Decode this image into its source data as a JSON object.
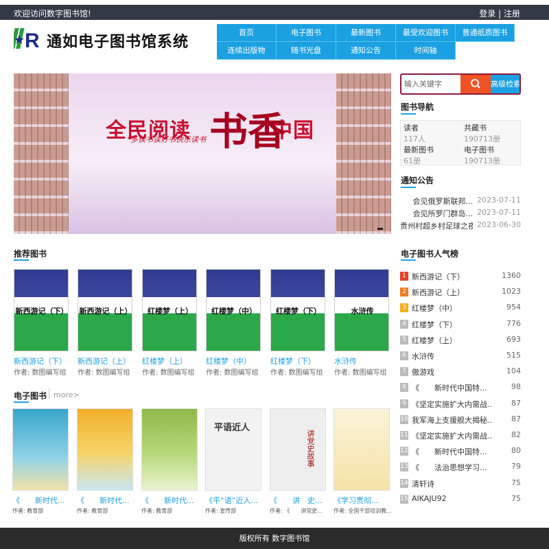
{
  "topbar": {
    "welcome": "欢迎访问数字图书馆!",
    "login": "登录",
    "sep": "|",
    "register": "注册"
  },
  "header": {
    "logo_mark": "R",
    "title": "通如电子图书馆系统"
  },
  "nav": [
    "首页",
    "电子图书",
    "最新图书",
    "最受欢迎图书",
    "普通纸质图书",
    "连续出版物",
    "随书光盘",
    "通知公告",
    "时间轴"
  ],
  "banner": {
    "main": "全民阅读",
    "big": "书香",
    "tail": "中国",
    "sub": "多读书读好书快乐读书"
  },
  "search": {
    "placeholder": "输入关键字",
    "advanced": "高级检索"
  },
  "book_nav": {
    "title": "图书导航",
    "stats": [
      {
        "label": "读者",
        "value": "117人"
      },
      {
        "label": "共藏书",
        "value": "190713册"
      },
      {
        "label": "最新图书",
        "value": "61册"
      },
      {
        "label": "电子图书",
        "value": "190713册"
      }
    ]
  },
  "notices": {
    "title": "通知公告",
    "items": [
      {
        "text": "会见俄罗斯联邦...",
        "date": "2023-07-11"
      },
      {
        "text": "会见所罗门群岛...",
        "date": "2023-07-11"
      },
      {
        "text": "贵州村超乡村足球之夜...",
        "date": "2023-06-30"
      }
    ]
  },
  "recommended": {
    "title": "推荐图书",
    "books": [
      {
        "cover": "新西游记（下）",
        "name": "新西游记（下）",
        "author": "作者: 数图编写组"
      },
      {
        "cover": "新西游记（上）",
        "name": "新西游记（上）",
        "author": "作者: 数图编写组"
      },
      {
        "cover": "红楼梦（上）",
        "name": "红楼梦（上）",
        "author": "作者: 数图编写组"
      },
      {
        "cover": "红楼梦（中）",
        "name": "红楼梦（中）",
        "author": "作者: 数图编写组"
      },
      {
        "cover": "红楼梦（下）",
        "name": "红楼梦（下）",
        "author": "作者: 数图编写组"
      },
      {
        "cover": "水浒传",
        "name": "水浒传",
        "author": "作者: 数图编写组"
      }
    ]
  },
  "ebooks": {
    "title": "电子图书",
    "more": "more>",
    "books": [
      {
        "name": "《　　新时代...",
        "author": "作者: 教育部",
        "color": "#3aa6c9"
      },
      {
        "name": "《　　新时代...",
        "author": "作者: 教育部",
        "color": "#f1b02c"
      },
      {
        "name": "《　　新时代...",
        "author": "作者: 教育部",
        "color": "#8fb94a"
      },
      {
        "name": "《平“语”近人...",
        "author": "作者: 宣传部",
        "color": "#f2f2f2",
        "cover_title": "平语近人"
      },
      {
        "name": "《　　讲　史...",
        "author": "作者: 《　　讲党史...",
        "color": "#eeeeee",
        "cover_title": "讲党史故事"
      },
      {
        "name": "《学习贯彻...",
        "author": "作者: 全国干部培训教...",
        "color": "#faf3d8"
      }
    ]
  },
  "ranking": {
    "title": "电子图书人气榜",
    "items": [
      {
        "n": "1",
        "name": "新西游记（下）",
        "count": "1360",
        "color": "#e2452b"
      },
      {
        "n": "2",
        "name": "新西游记（上）",
        "count": "1023",
        "color": "#f07a22"
      },
      {
        "n": "3",
        "name": "红楼梦（中）",
        "count": "954",
        "color": "#f5b21f"
      },
      {
        "n": "4",
        "name": "红楼梦（下）",
        "count": "776",
        "color": "#bbbbbb"
      },
      {
        "n": "5",
        "name": "红楼梦（上）",
        "count": "693",
        "color": "#bbbbbb"
      },
      {
        "n": "6",
        "name": "水浒传",
        "count": "515",
        "color": "#bbbbbb"
      },
      {
        "n": "7",
        "name": "傲游戏",
        "count": "104",
        "color": "#bbbbbb"
      },
      {
        "n": "8",
        "name": "《　　新时代中国特...",
        "count": "98",
        "color": "#bbbbbb"
      },
      {
        "n": "9",
        "name": "《坚定实施扩大内需战...",
        "count": "87",
        "color": "#bbbbbb"
      },
      {
        "n": "10",
        "name": "我军海上支援舰大揭秘...",
        "count": "87",
        "color": "#bbbbbb"
      },
      {
        "n": "11",
        "name": "《坚定实施扩大内需战...",
        "count": "82",
        "color": "#bbbbbb"
      },
      {
        "n": "12",
        "name": "《　　新时代中国特...",
        "count": "80",
        "color": "#bbbbbb"
      },
      {
        "n": "13",
        "name": "《　　法治思想学习...",
        "count": "79",
        "color": "#bbbbbb"
      },
      {
        "n": "14",
        "name": "清轩诗",
        "count": "75",
        "color": "#bbbbbb"
      },
      {
        "n": "15",
        "name": "AIKAJU92",
        "count": "75",
        "color": "#bbbbbb"
      }
    ]
  },
  "footer": {
    "text": "版权所有 数字图书馆"
  }
}
